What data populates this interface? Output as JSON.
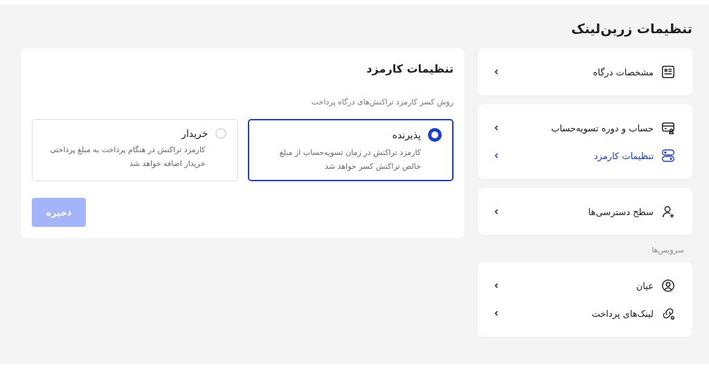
{
  "page_title": "تنظیمات زرین‌لینک",
  "sidebar": [
    {
      "kind": "card",
      "items": [
        {
          "label": "مشخصات درگاه",
          "selected": false
        }
      ]
    },
    {
      "kind": "card",
      "items": [
        {
          "label": "حساب و دوره تسویه‌حساب",
          "selected": false
        },
        {
          "label": "تنظیمات کارمزد",
          "selected": true
        }
      ]
    },
    {
      "kind": "card",
      "items": [
        {
          "label": "سطح دسترسی‌ها",
          "selected": false
        }
      ]
    },
    {
      "kind": "heading",
      "label": "سرویس‌ها"
    },
    {
      "kind": "card",
      "items": [
        {
          "label": "عیان",
          "selected": false
        },
        {
          "label": "لینک‌های پرداخت",
          "selected": false
        }
      ]
    }
  ],
  "panel": {
    "title": "تنظیمات کارمزد",
    "subtitle": "روش کسر کارمزد تراکنش‌های درگاه پرداخت",
    "options": [
      {
        "title": "پذیرنده",
        "description": "کارمزد تراکنش در زمان تسویه‌حساب از مبلغ خالص تراکنش کسر خواهد شد",
        "selected": true
      },
      {
        "title": "خریدار",
        "description": "کارمزد تراکنش در هنگام پرداخت به مبلغ پرداختی خریدار اضافه خواهد شد",
        "selected": false
      }
    ],
    "save_button": {
      "label": "ذخیره",
      "disabled": true
    }
  }
}
